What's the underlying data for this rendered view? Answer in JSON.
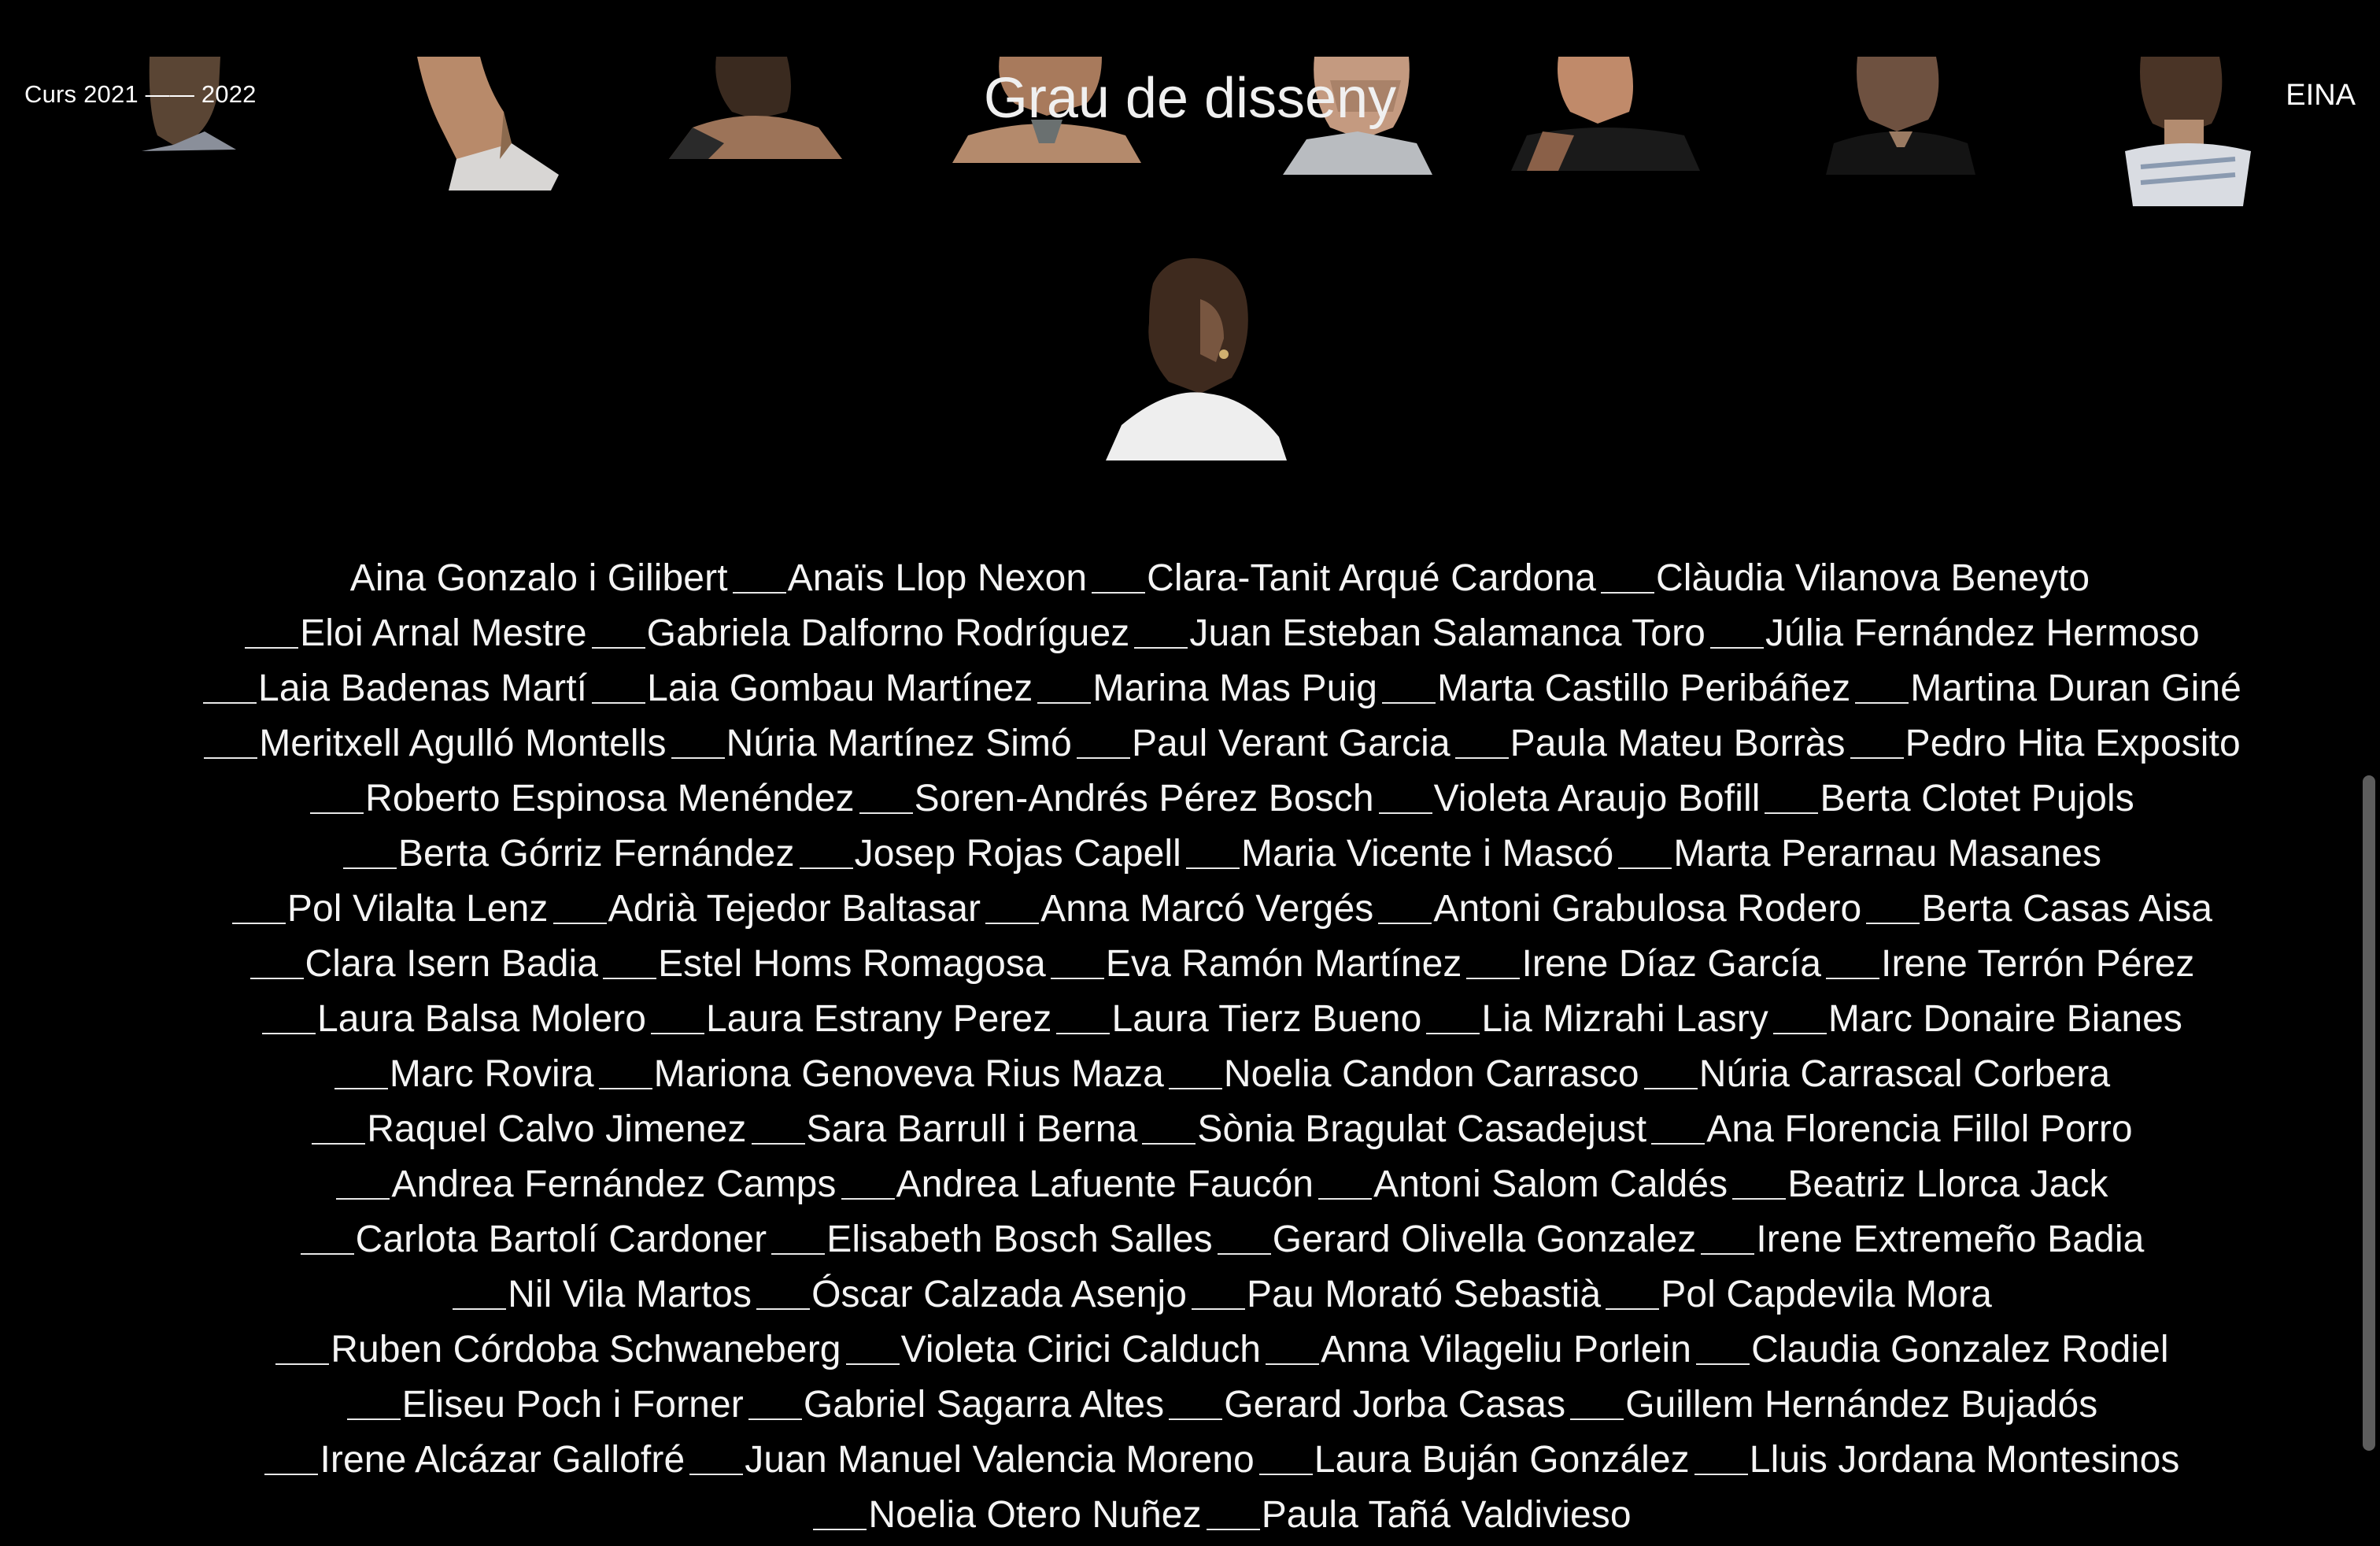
{
  "header": {
    "course": "Curs 2021 —— 2022",
    "title": "Grau de disseny",
    "brand": "EINA"
  },
  "names_lines": [
    [
      "Aina Gonzalo i Gilibert",
      "Anaïs Llop Nexon",
      "Clara-Tanit Arqué Cardona",
      "Clàudia Vilanova Beneyto"
    ],
    [
      "Eloi Arnal Mestre",
      "Gabriela Dalforno Rodríguez",
      "Juan Esteban Salamanca Toro",
      "Júlia Fernández Hermoso"
    ],
    [
      "Laia Badenas Martí",
      "Laia Gombau Martínez",
      "Marina Mas Puig",
      "Marta Castillo Peribáñez",
      "Martina Duran Giné"
    ],
    [
      "Meritxell Agulló Montells",
      "Núria Martínez Simó",
      "Paul Verant Garcia",
      "Paula Mateu Borràs",
      "Pedro Hita Exposito"
    ],
    [
      "Roberto Espinosa Menéndez",
      "Soren-Andrés Pérez Bosch",
      "Violeta Araujo Bofill",
      "Berta Clotet Pujols"
    ],
    [
      "Berta Górriz Fernández",
      "Josep Rojas Capell",
      "Maria Vicente i Mascó",
      "Marta Perarnau Masanes"
    ],
    [
      "Pol Vilalta Lenz",
      "Adrià Tejedor Baltasar",
      "Anna Marcó Vergés",
      "Antoni Grabulosa Rodero",
      "Berta Casas Aisa"
    ],
    [
      "Clara Isern Badia",
      "Estel Homs Romagosa",
      "Eva Ramón Martínez",
      "Irene Díaz García",
      "Irene Terrón Pérez"
    ],
    [
      "Laura Balsa Molero",
      "Laura Estrany Perez",
      "Laura Tierz Bueno",
      "Lia Mizrahi Lasry",
      "Marc Donaire Bianes"
    ],
    [
      "Marc Rovira",
      "Mariona Genoveva Rius Maza",
      "Noelia Candon Carrasco",
      "Núria Carrascal Corbera"
    ],
    [
      "Raquel Calvo Jimenez",
      "Sara Barrull i Berna",
      "Sònia Bragulat Casadejust",
      "Ana Florencia Fillol Porro"
    ],
    [
      "Andrea Fernández Camps",
      "Andrea Lafuente Faucón",
      "Antoni Salom Caldés",
      "Beatriz Llorca Jack"
    ],
    [
      "Carlota Bartolí Cardoner",
      "Elisabeth Bosch Salles",
      "Gerard Olivella Gonzalez",
      "Irene Extremeño Badia"
    ],
    [
      "Nil Vila Martos",
      "Óscar Calzada Asenjo",
      "Pau Morató Sebastià",
      "Pol Capdevila Mora"
    ],
    [
      "Ruben Córdoba Schwaneberg",
      "Violeta Cirici Calduch",
      "Anna Vilageliu Porlein",
      "Claudia Gonzalez Rodiel"
    ],
    [
      "Eliseu Poch i Forner",
      "Gabriel Sagarra Altes",
      "Gerard Jorba Casas",
      "Guillem Hernández Bujadós"
    ],
    [
      "Irene Alcázar Gallofré",
      "Juan Manuel Valencia Moreno",
      "Laura Buján González",
      "Lluis Jordana Montesinos"
    ],
    [
      "Noelia Otero Nuñez",
      "Paula Tañá Valdivieso"
    ]
  ],
  "first_line_leading_dash": false,
  "colors": {
    "background": "#000000",
    "text": "#f4f4f4",
    "scrollbar_thumb": "#5d5d5d"
  }
}
